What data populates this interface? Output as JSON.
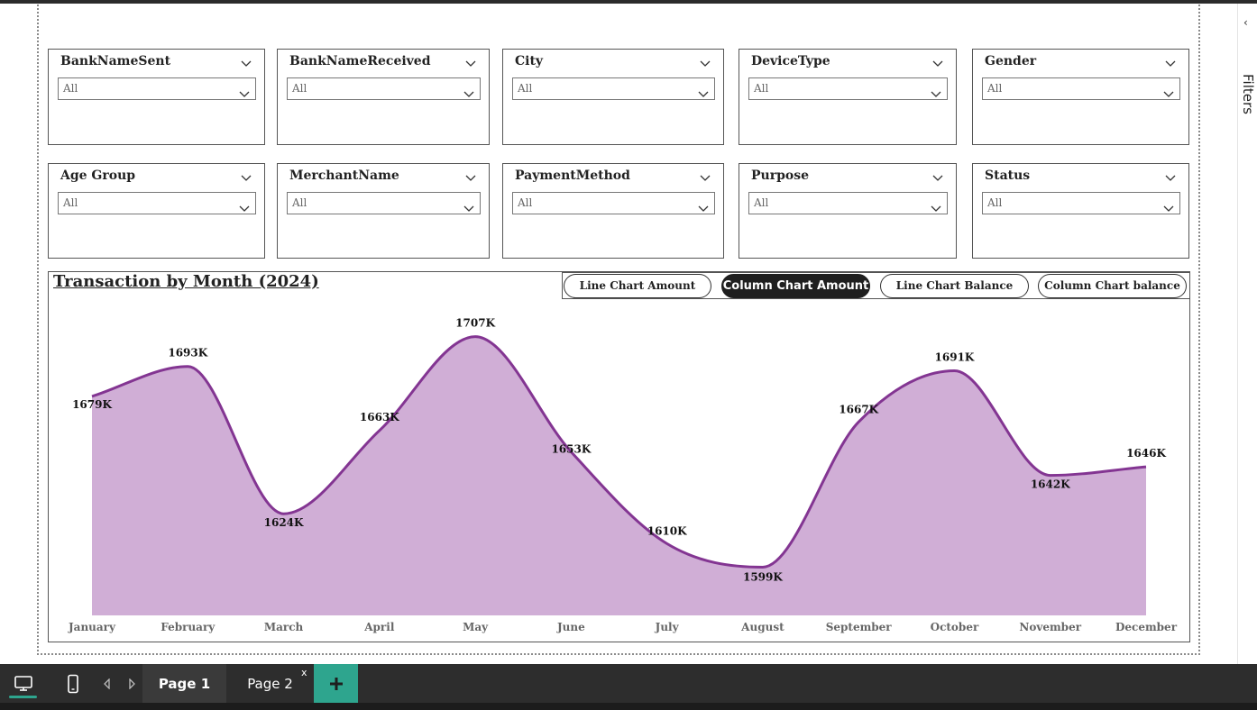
{
  "sidebar_pane": {
    "label": "Filters"
  },
  "slicers": [
    {
      "title": "BankNameSent",
      "value": "All"
    },
    {
      "title": "BankNameReceived",
      "value": "All"
    },
    {
      "title": "City",
      "value": "All"
    },
    {
      "title": "DeviceType",
      "value": "All"
    },
    {
      "title": "Gender",
      "value": "All"
    },
    {
      "title": "Age Group",
      "value": "All"
    },
    {
      "title": "MerchantName",
      "value": "All"
    },
    {
      "title": "PaymentMethod",
      "value": "All"
    },
    {
      "title": "Purpose",
      "value": "All"
    },
    {
      "title": "Status",
      "value": "All"
    }
  ],
  "chart_buttons": [
    {
      "label": "Line Chart Amount",
      "active": false
    },
    {
      "label": "Column Chart Amount",
      "active": true
    },
    {
      "label": "Line Chart Balance",
      "active": false
    },
    {
      "label": "Column Chart balance",
      "active": false
    }
  ],
  "chart_data": {
    "type": "area",
    "title": "Transaction by Month (2024)",
    "categories": [
      "January",
      "February",
      "March",
      "April",
      "May",
      "June",
      "July",
      "August",
      "September",
      "October",
      "November",
      "December"
    ],
    "values": [
      1679,
      1693,
      1624,
      1663,
      1707,
      1653,
      1610,
      1599,
      1667,
      1691,
      1642,
      1646
    ],
    "labels": [
      "1679K",
      "1693K",
      "1624K",
      "1663K",
      "1707K",
      "1653K",
      "1610K",
      "1599K",
      "1667K",
      "1691K",
      "1642K",
      "1646K"
    ],
    "unit": "K",
    "smooth": true,
    "fill_color": "#d0aed6",
    "line_color": "#833592",
    "grid": false,
    "legend": "none"
  },
  "tabs": [
    {
      "label": "Page 1",
      "active": true
    },
    {
      "label": "Page 2",
      "active": false
    }
  ],
  "tab_close_label": "x",
  "colors": {
    "accent": "#2ea58e",
    "bar": "#2d2d2d"
  }
}
